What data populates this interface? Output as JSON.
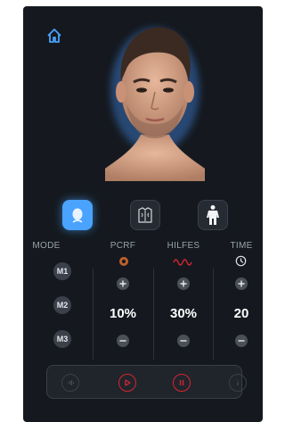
{
  "controls": {
    "headers": {
      "mode": "MODE",
      "pcrf": "PCRF",
      "hilfes": "HILFES",
      "time": "TIME"
    },
    "mode_buttons": [
      "M1",
      "M2",
      "M3"
    ],
    "pcrf_value": "10%",
    "hilfes_value": "30%",
    "time_value": "20"
  },
  "colors": {
    "background": "#15191f",
    "accent_blue": "#4aa3ff",
    "accent_red": "#d8242f",
    "pcrf_icon": "#c0612a"
  },
  "icons": {
    "home": "home-icon",
    "face": "face-icon",
    "torso": "torso-icon",
    "full_body": "full-body-icon",
    "pcrf": "pcrf-icon",
    "hilfes": "wave-icon",
    "time": "clock-icon"
  }
}
